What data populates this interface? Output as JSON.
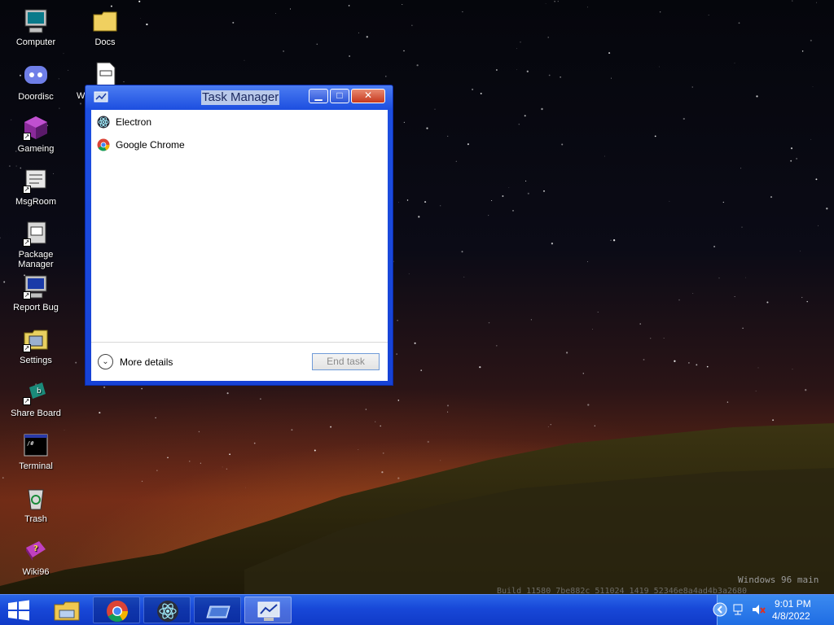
{
  "desktop": {
    "icons": [
      {
        "label": "Computer"
      },
      {
        "label": "Doordisc"
      },
      {
        "label": "Gameing"
      },
      {
        "label": "MsgRoom"
      },
      {
        "label": "Package Manager"
      },
      {
        "label": "Report Bug"
      },
      {
        "label": "Settings"
      },
      {
        "label": "Share Board"
      },
      {
        "label": "Terminal"
      },
      {
        "label": "Trash"
      },
      {
        "label": "Wiki96"
      },
      {
        "label": "Docs"
      }
    ],
    "partial_label": "W",
    "watermark": "Windows 96 main",
    "build_text": "Build 11580 7be882c 511024 1419 52346e8a4ad4b3a2680"
  },
  "task_manager": {
    "title": "Task Manager",
    "processes": [
      {
        "name": "Electron",
        "icon": "electron-icon"
      },
      {
        "name": "Google Chrome",
        "icon": "chrome-icon"
      }
    ],
    "more_details_label": "More details",
    "end_task_label": "End task"
  },
  "taskbar": {
    "items": [
      "start-icon",
      "file-explorer-icon",
      "chrome-icon",
      "electron-icon",
      "window-icon",
      "task-manager-icon"
    ],
    "clock_time": "9:01 PM",
    "clock_date": "4/8/2022"
  },
  "colors": {
    "taskbar": "#1848d8",
    "window_frame": "#1642d6",
    "title_highlight": "#b9c9ea"
  }
}
